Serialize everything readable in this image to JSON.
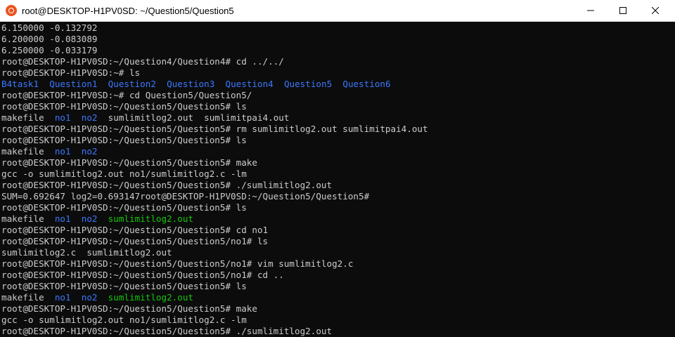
{
  "window": {
    "title": "root@DESKTOP-H1PV0SD: ~/Question5/Question5",
    "icon": "ubuntu-icon",
    "controls": {
      "minimize": "minimize-icon",
      "maximize": "maximize-icon",
      "close": "close-icon"
    }
  },
  "colors": {
    "text": "#cccccc",
    "background": "#0c0c0c",
    "directory": "#3b78ff",
    "executable": "#16c60c"
  },
  "terminal": {
    "lines": [
      [
        {
          "t": "6.150000 -0.132792"
        }
      ],
      [
        {
          "t": "6.200000 -0.083089"
        }
      ],
      [
        {
          "t": "6.250000 -0.033179"
        }
      ],
      [
        {
          "t": "root@DESKTOP-H1PV0SD:~/Question4/Question4# cd ../../"
        }
      ],
      [
        {
          "t": "root@DESKTOP-H1PV0SD:~# ls"
        }
      ],
      [
        {
          "t": "B4task1",
          "c": "blue"
        },
        {
          "t": "  "
        },
        {
          "t": "Question1",
          "c": "blue"
        },
        {
          "t": "  "
        },
        {
          "t": "Question2",
          "c": "blue"
        },
        {
          "t": "  "
        },
        {
          "t": "Question3",
          "c": "blue"
        },
        {
          "t": "  "
        },
        {
          "t": "Question4",
          "c": "blue"
        },
        {
          "t": "  "
        },
        {
          "t": "Question5",
          "c": "blue"
        },
        {
          "t": "  "
        },
        {
          "t": "Question6",
          "c": "blue"
        }
      ],
      [
        {
          "t": "root@DESKTOP-H1PV0SD:~# cd Question5/Question5/"
        }
      ],
      [
        {
          "t": "root@DESKTOP-H1PV0SD:~/Question5/Question5# ls"
        }
      ],
      [
        {
          "t": "makefile  "
        },
        {
          "t": "no1",
          "c": "blue"
        },
        {
          "t": "  "
        },
        {
          "t": "no2",
          "c": "blue"
        },
        {
          "t": "  sumlimitlog2.out  sumlimitpai4.out"
        }
      ],
      [
        {
          "t": "root@DESKTOP-H1PV0SD:~/Question5/Question5# rm sumlimitlog2.out sumlimitpai4.out"
        }
      ],
      [
        {
          "t": "root@DESKTOP-H1PV0SD:~/Question5/Question5# ls"
        }
      ],
      [
        {
          "t": "makefile  "
        },
        {
          "t": "no1",
          "c": "blue"
        },
        {
          "t": "  "
        },
        {
          "t": "no2",
          "c": "blue"
        }
      ],
      [
        {
          "t": "root@DESKTOP-H1PV0SD:~/Question5/Question5# make"
        }
      ],
      [
        {
          "t": "gcc -o sumlimitlog2.out no1/sumlimitlog2.c -lm"
        }
      ],
      [
        {
          "t": "root@DESKTOP-H1PV0SD:~/Question5/Question5# ./sumlimitlog2.out"
        }
      ],
      [
        {
          "t": "SUM=0.692647 log2=0.693147root@DESKTOP-H1PV0SD:~/Question5/Question5#"
        }
      ],
      [
        {
          "t": "root@DESKTOP-H1PV0SD:~/Question5/Question5# ls"
        }
      ],
      [
        {
          "t": "makefile  "
        },
        {
          "t": "no1",
          "c": "blue"
        },
        {
          "t": "  "
        },
        {
          "t": "no2",
          "c": "blue"
        },
        {
          "t": "  "
        },
        {
          "t": "sumlimitlog2.out",
          "c": "green"
        }
      ],
      [
        {
          "t": "root@DESKTOP-H1PV0SD:~/Question5/Question5# cd no1"
        }
      ],
      [
        {
          "t": "root@DESKTOP-H1PV0SD:~/Question5/Question5/no1# ls"
        }
      ],
      [
        {
          "t": "sumlimitlog2.c  sumlimitlog2.out"
        }
      ],
      [
        {
          "t": "root@DESKTOP-H1PV0SD:~/Question5/Question5/no1# vim sumlimitlog2.c"
        }
      ],
      [
        {
          "t": "root@DESKTOP-H1PV0SD:~/Question5/Question5/no1# cd .."
        }
      ],
      [
        {
          "t": "root@DESKTOP-H1PV0SD:~/Question5/Question5# ls"
        }
      ],
      [
        {
          "t": "makefile  "
        },
        {
          "t": "no1",
          "c": "blue"
        },
        {
          "t": "  "
        },
        {
          "t": "no2",
          "c": "blue"
        },
        {
          "t": "  "
        },
        {
          "t": "sumlimitlog2.out",
          "c": "green"
        }
      ],
      [
        {
          "t": "root@DESKTOP-H1PV0SD:~/Question5/Question5# make"
        }
      ],
      [
        {
          "t": "gcc -o sumlimitlog2.out no1/sumlimitlog2.c -lm"
        }
      ],
      [
        {
          "t": "root@DESKTOP-H1PV0SD:~/Question5/Question5# ./sumlimitlog2.out"
        }
      ]
    ]
  }
}
